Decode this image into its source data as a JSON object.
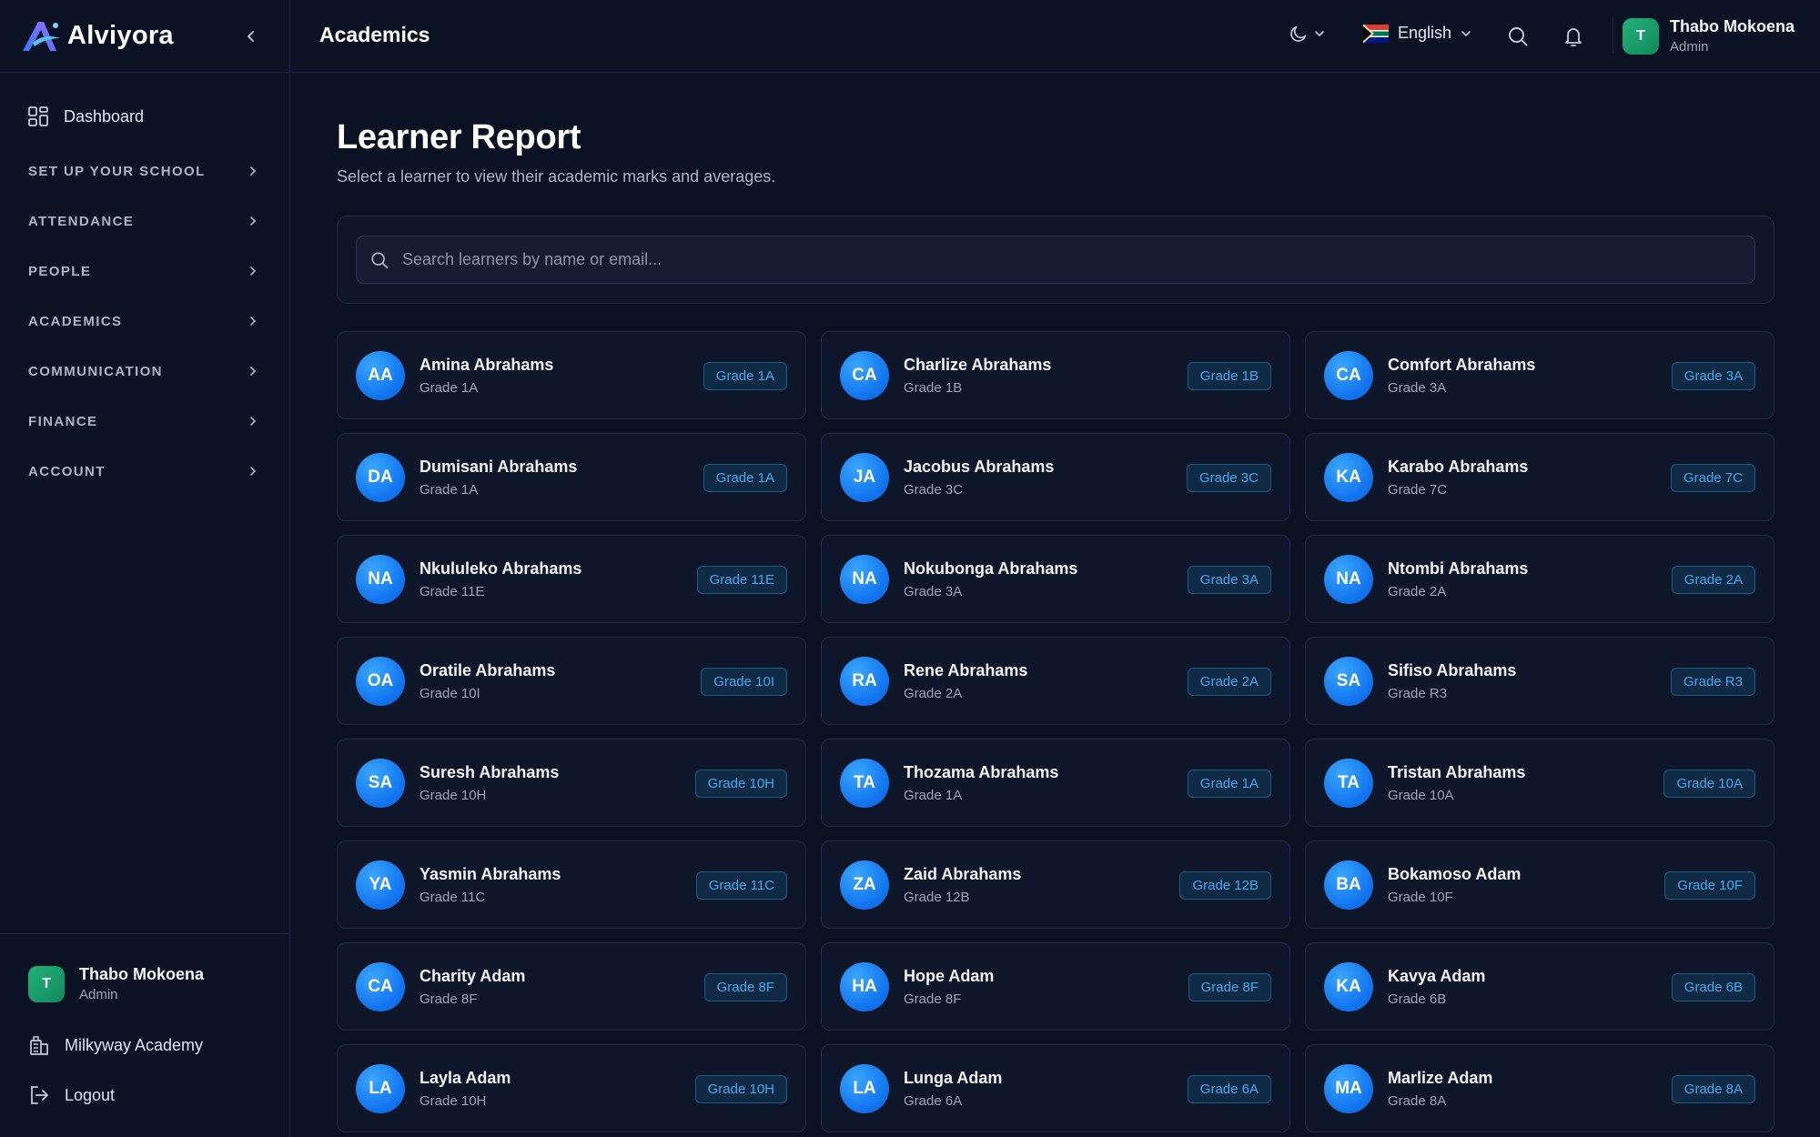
{
  "brand": {
    "name": "Alviyora"
  },
  "header": {
    "title": "Academics",
    "language": "English",
    "user": {
      "initial": "T",
      "name": "Thabo Mokoena",
      "role": "Admin"
    }
  },
  "sidebar": {
    "dashboard_label": "Dashboard",
    "sections": [
      "SET UP YOUR SCHOOL",
      "ATTENDANCE",
      "PEOPLE",
      "ACADEMICS",
      "COMMUNICATION",
      "FINANCE",
      "ACCOUNT"
    ],
    "footer": {
      "initial": "T",
      "name": "Thabo Mokoena",
      "role": "Admin",
      "school": "Milkyway Academy",
      "logout": "Logout"
    }
  },
  "main": {
    "title": "Learner Report",
    "subtitle": "Select a learner to view their academic marks and averages.",
    "search_placeholder": "Search learners by name or email...",
    "learners": [
      {
        "initials": "AA",
        "name": "Amina Abrahams",
        "grade": "Grade 1A"
      },
      {
        "initials": "CA",
        "name": "Charlize Abrahams",
        "grade": "Grade 1B"
      },
      {
        "initials": "CA",
        "name": "Comfort Abrahams",
        "grade": "Grade 3A"
      },
      {
        "initials": "DA",
        "name": "Dumisani Abrahams",
        "grade": "Grade 1A"
      },
      {
        "initials": "JA",
        "name": "Jacobus Abrahams",
        "grade": "Grade 3C"
      },
      {
        "initials": "KA",
        "name": "Karabo Abrahams",
        "grade": "Grade 7C"
      },
      {
        "initials": "NA",
        "name": "Nkululeko Abrahams",
        "grade": "Grade 11E"
      },
      {
        "initials": "NA",
        "name": "Nokubonga Abrahams",
        "grade": "Grade 3A"
      },
      {
        "initials": "NA",
        "name": "Ntombi Abrahams",
        "grade": "Grade 2A"
      },
      {
        "initials": "OA",
        "name": "Oratile Abrahams",
        "grade": "Grade 10I"
      },
      {
        "initials": "RA",
        "name": "Rene Abrahams",
        "grade": "Grade 2A"
      },
      {
        "initials": "SA",
        "name": "Sifiso Abrahams",
        "grade": "Grade R3"
      },
      {
        "initials": "SA",
        "name": "Suresh Abrahams",
        "grade": "Grade 10H"
      },
      {
        "initials": "TA",
        "name": "Thozama Abrahams",
        "grade": "Grade 1A"
      },
      {
        "initials": "TA",
        "name": "Tristan Abrahams",
        "grade": "Grade 10A"
      },
      {
        "initials": "YA",
        "name": "Yasmin Abrahams",
        "grade": "Grade 11C"
      },
      {
        "initials": "ZA",
        "name": "Zaid Abrahams",
        "grade": "Grade 12B"
      },
      {
        "initials": "BA",
        "name": "Bokamoso Adam",
        "grade": "Grade 10F"
      },
      {
        "initials": "CA",
        "name": "Charity Adam",
        "grade": "Grade 8F"
      },
      {
        "initials": "HA",
        "name": "Hope Adam",
        "grade": "Grade 8F"
      },
      {
        "initials": "KA",
        "name": "Kavya Adam",
        "grade": "Grade 6B"
      },
      {
        "initials": "LA",
        "name": "Layla Adam",
        "grade": "Grade 10H"
      },
      {
        "initials": "LA",
        "name": "Lunga Adam",
        "grade": "Grade 6A"
      },
      {
        "initials": "MA",
        "name": "Marlize Adam",
        "grade": "Grade 8A"
      }
    ]
  },
  "colors": {
    "background": "#0a1122",
    "accent": "#1275f0",
    "badge_text": "#46a8f0",
    "avatar_green": "#22b07a"
  }
}
